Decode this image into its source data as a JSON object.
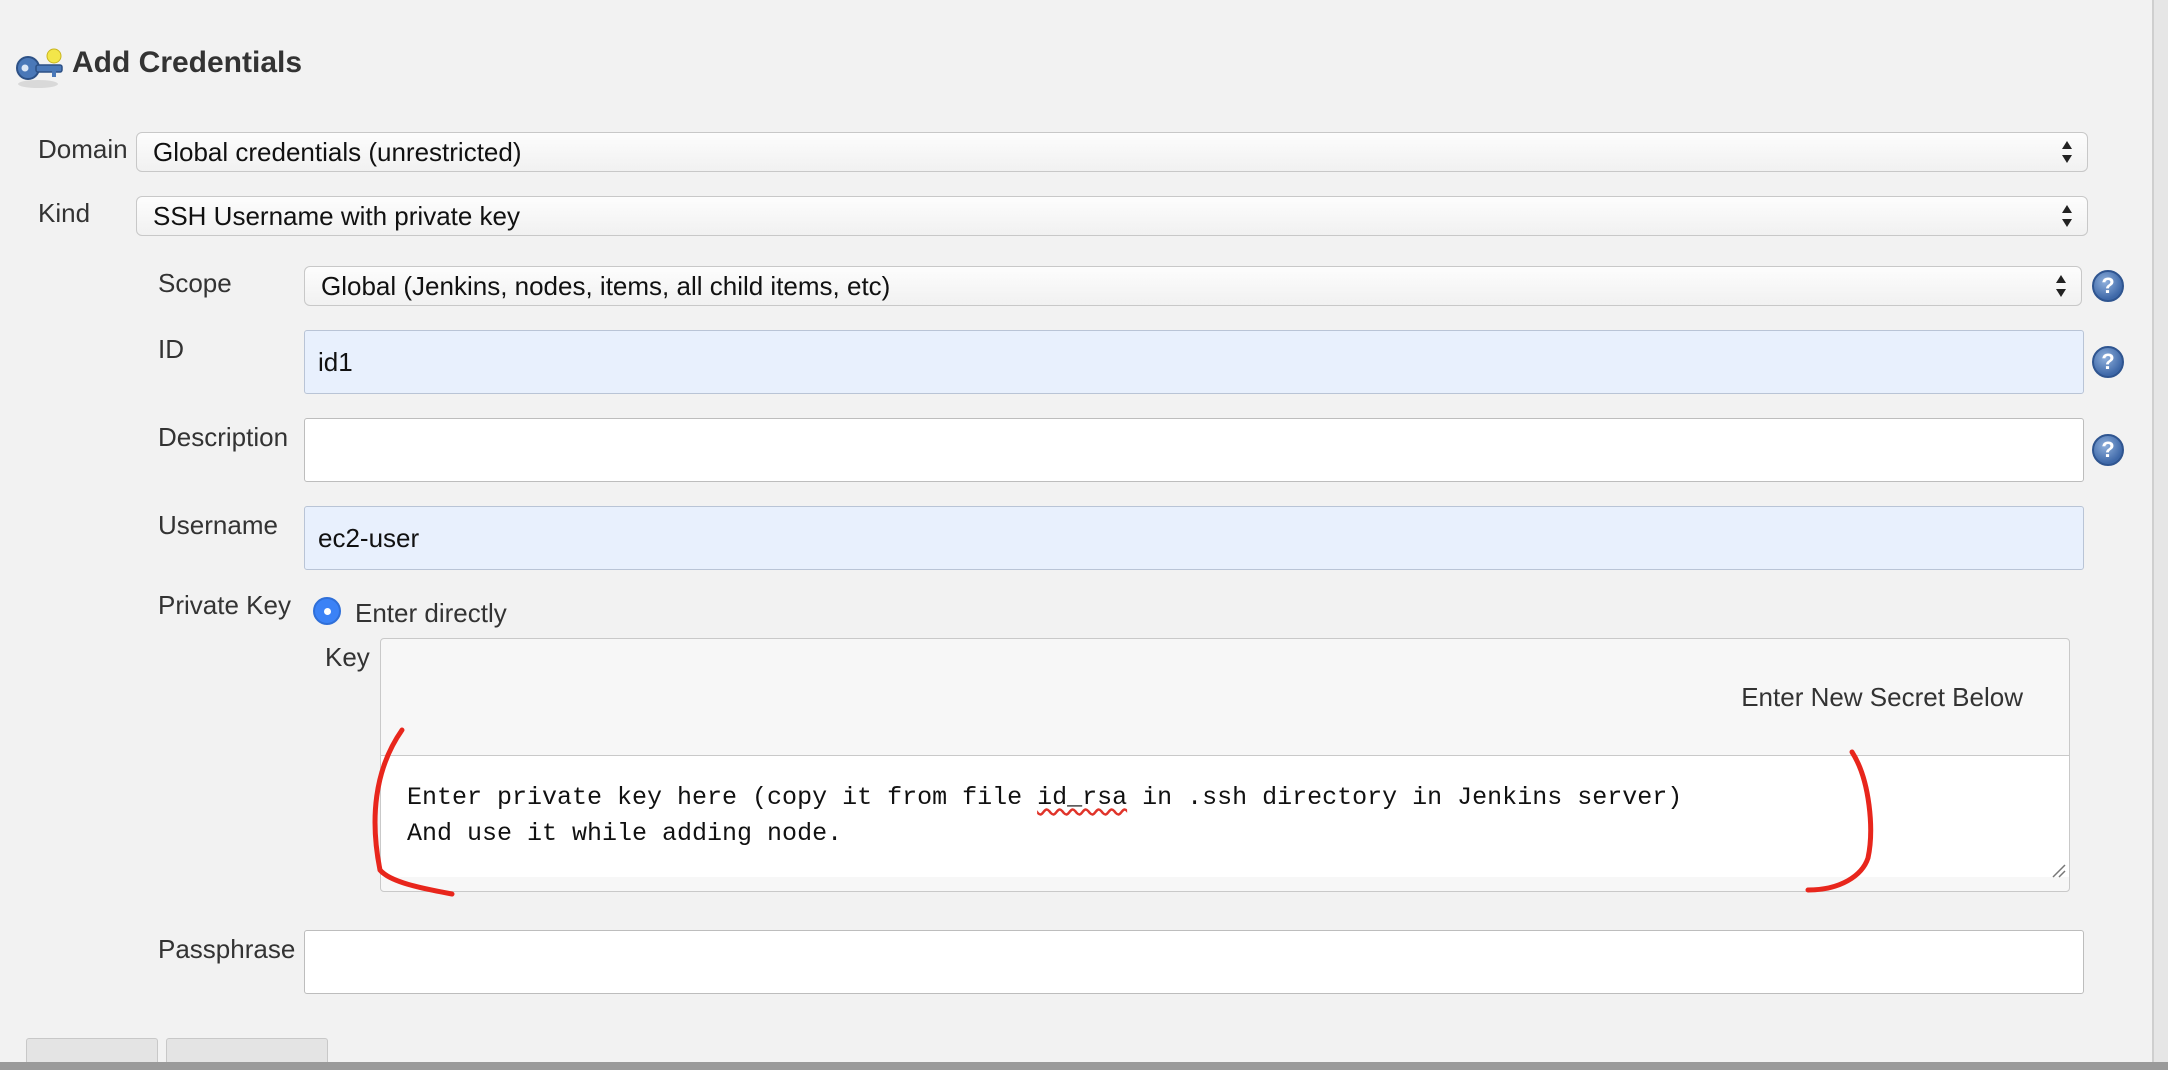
{
  "dialog": {
    "title": "Add Credentials",
    "icon": "key-icon"
  },
  "domain": {
    "label": "Domain",
    "value": "Global credentials (unrestricted)"
  },
  "kind": {
    "label": "Kind",
    "value": "SSH Username with private key"
  },
  "scope": {
    "label": "Scope",
    "value": "Global (Jenkins, nodes, items, all child items, etc)"
  },
  "id_field": {
    "label": "ID",
    "value": "id1"
  },
  "description": {
    "label": "Description",
    "value": ""
  },
  "username": {
    "label": "Username",
    "value": "ec2-user"
  },
  "private_key": {
    "label": "Private Key",
    "option_label": "Enter directly",
    "key_label": "Key",
    "secret_notice": "Enter New Secret Below",
    "line1_prefix": "Enter private key here (copy it from file ",
    "line1_misspelled": "id_rsa",
    "line1_suffix": " in .ssh directory in Jenkins server)",
    "line2": "And use it while adding node."
  },
  "passphrase": {
    "label": "Passphrase",
    "value": ""
  },
  "help_icon_glyph": "?",
  "colors": {
    "annotation": "#e8261c",
    "filled_input_bg": "#e8f0fd",
    "radio_accent": "#3b82f6",
    "help_icon": "#3e68a8"
  }
}
